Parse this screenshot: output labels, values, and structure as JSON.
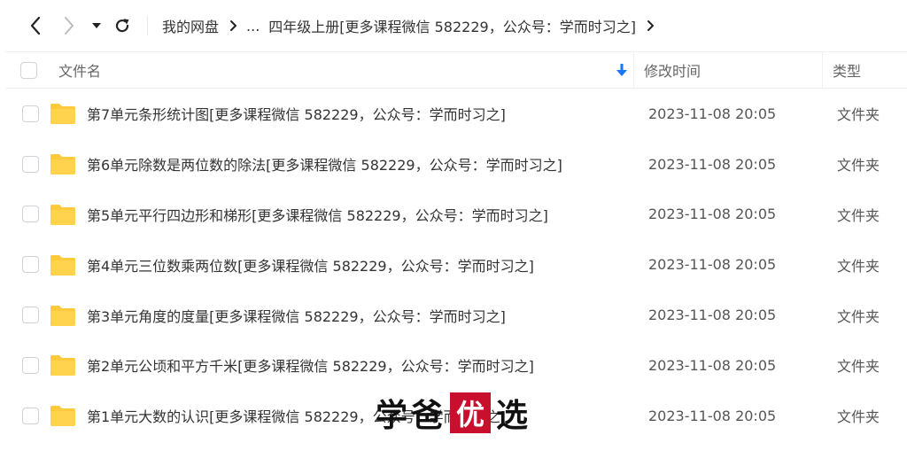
{
  "nav": {
    "breadcrumb_root": "我的网盘",
    "breadcrumb_ellipsis": "...",
    "breadcrumb_current": "四年级上册[更多课程微信 582229，公众号：学而时习之]"
  },
  "header": {
    "name": "文件名",
    "date": "修改时间",
    "type": "类型"
  },
  "colors": {
    "folder": "#FFC93D",
    "sort_icon": "#1677ff",
    "watermark_box": "#C8102E"
  },
  "rows": [
    {
      "name": "第7单元条形统计图[更多课程微信 582229，公众号：学而时习之]",
      "date": "2023-11-08 20:05",
      "type": "文件夹"
    },
    {
      "name": "第6单元除数是两位数的除法[更多课程微信 582229，公众号：学而时习之]",
      "date": "2023-11-08 20:05",
      "type": "文件夹"
    },
    {
      "name": "第5单元平行四边形和梯形[更多课程微信 582229，公众号：学而时习之]",
      "date": "2023-11-08 20:05",
      "type": "文件夹"
    },
    {
      "name": "第4单元三位数乘两位数[更多课程微信 582229，公众号：学而时习之]",
      "date": "2023-11-08 20:05",
      "type": "文件夹"
    },
    {
      "name": "第3单元角度的度量[更多课程微信 582229，公众号：学而时习之]",
      "date": "2023-11-08 20:05",
      "type": "文件夹"
    },
    {
      "name": "第2单元公顷和平方千米[更多课程微信 582229，公众号：学而时习之]",
      "date": "2023-11-08 20:05",
      "type": "文件夹"
    },
    {
      "name": "第1单元大数的认识[更多课程微信 582229，公众号：学而时习之]",
      "date": "2023-11-08 20:05",
      "type": "文件夹"
    }
  ],
  "watermark": {
    "char1": "学",
    "char2": "爸",
    "char3": "优",
    "char4": "选"
  }
}
